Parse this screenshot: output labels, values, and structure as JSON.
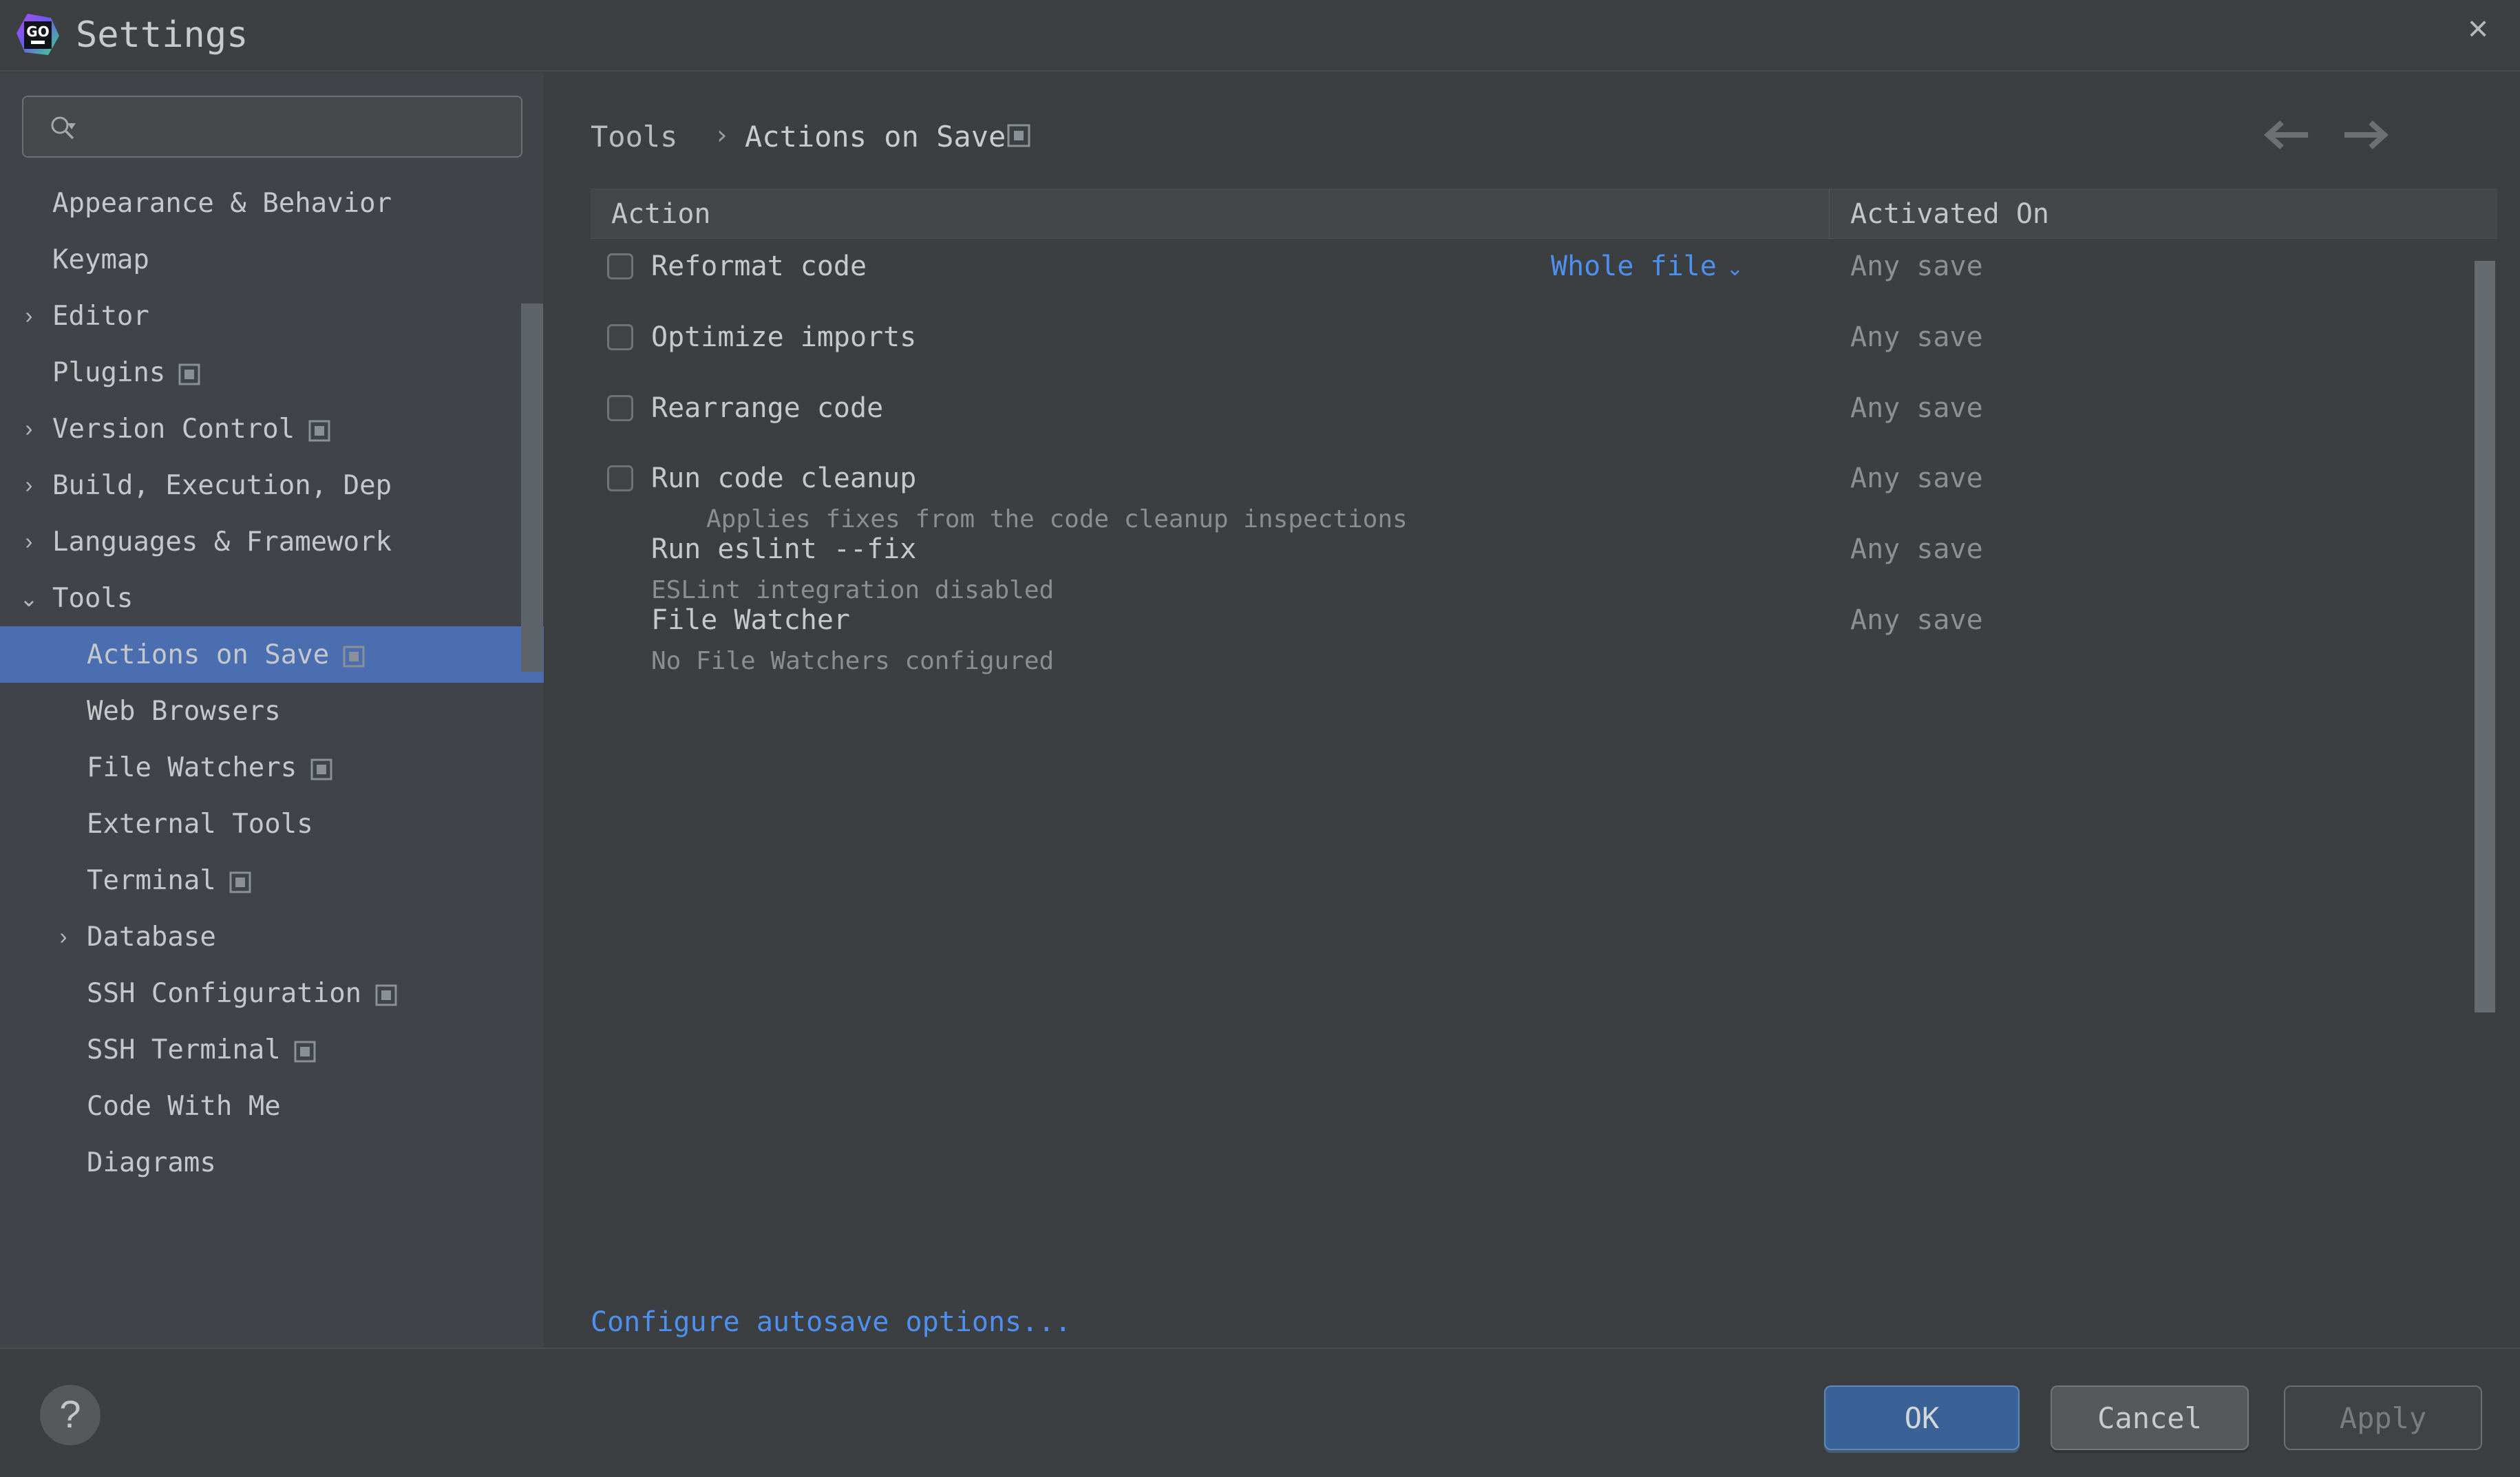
{
  "window": {
    "title": "Settings",
    "logo_text": "GO",
    "close_icon": "×"
  },
  "sidebar": {
    "search": {
      "value": "",
      "placeholder": ""
    },
    "items": [
      {
        "label": "Appearance & Behavior",
        "indent": 0,
        "chevron": "",
        "badge": false,
        "selected": false
      },
      {
        "label": "Keymap",
        "indent": 0,
        "chevron": "",
        "badge": false,
        "selected": false
      },
      {
        "label": "Editor",
        "indent": 0,
        "chevron": "›",
        "badge": false,
        "selected": false
      },
      {
        "label": "Plugins",
        "indent": 0,
        "chevron": "",
        "badge": true,
        "selected": false
      },
      {
        "label": "Version Control",
        "indent": 0,
        "chevron": "›",
        "badge": true,
        "selected": false
      },
      {
        "label": "Build, Execution, Dep",
        "indent": 0,
        "chevron": "›",
        "badge": false,
        "selected": false
      },
      {
        "label": "Languages & Framework",
        "indent": 0,
        "chevron": "›",
        "badge": false,
        "selected": false
      },
      {
        "label": "Tools",
        "indent": 0,
        "chevron": "⌄",
        "badge": false,
        "selected": false
      },
      {
        "label": "Actions on Save",
        "indent": 1,
        "chevron": "",
        "badge": true,
        "selected": true
      },
      {
        "label": "Web Browsers",
        "indent": 1,
        "chevron": "",
        "badge": false,
        "selected": false
      },
      {
        "label": "File Watchers",
        "indent": 1,
        "chevron": "",
        "badge": true,
        "selected": false
      },
      {
        "label": "External Tools",
        "indent": 1,
        "chevron": "",
        "badge": false,
        "selected": false
      },
      {
        "label": "Terminal",
        "indent": 1,
        "chevron": "",
        "badge": true,
        "selected": false
      },
      {
        "label": "Database",
        "indent": 1,
        "chevron": "›",
        "badge": false,
        "selected": false
      },
      {
        "label": "SSH Configuration",
        "indent": 1,
        "chevron": "",
        "badge": true,
        "selected": false
      },
      {
        "label": "SSH Terminal",
        "indent": 1,
        "chevron": "",
        "badge": true,
        "selected": false
      },
      {
        "label": "Code With Me",
        "indent": 1,
        "chevron": "",
        "badge": false,
        "selected": false
      },
      {
        "label": "Diagrams",
        "indent": 1,
        "chevron": "",
        "badge": false,
        "selected": false
      }
    ]
  },
  "content": {
    "breadcrumb": {
      "root": "Tools",
      "separator": "›",
      "leaf": "Actions on Save"
    },
    "nav": {
      "back_icon": "←",
      "forward_icon": "→"
    },
    "table": {
      "columns": [
        "Action",
        "Activated On"
      ],
      "rows": [
        {
          "label": "Reformat code",
          "checkbox": true,
          "checked": false,
          "description": "",
          "option": "Whole file",
          "option_chevron": "⌄",
          "activated_on": "Any save"
        },
        {
          "label": "Optimize imports",
          "checkbox": true,
          "checked": false,
          "description": "",
          "option": "",
          "option_chevron": "",
          "activated_on": "Any save"
        },
        {
          "label": "Rearrange code",
          "checkbox": true,
          "checked": false,
          "description": "",
          "option": "",
          "option_chevron": "",
          "activated_on": "Any save"
        },
        {
          "label": "Run code cleanup",
          "checkbox": true,
          "checked": false,
          "description": "Applies fixes from the code cleanup inspections",
          "option": "",
          "option_chevron": "",
          "activated_on": "Any save"
        },
        {
          "label": "Run eslint --fix",
          "checkbox": false,
          "checked": false,
          "description": "ESLint integration disabled",
          "option": "",
          "option_chevron": "",
          "activated_on": "Any save"
        },
        {
          "label": "File Watcher",
          "checkbox": false,
          "checked": false,
          "description": "No File Watchers configured",
          "option": "",
          "option_chevron": "",
          "activated_on": "Any save"
        }
      ]
    },
    "autosave_link": "Configure autosave options..."
  },
  "footer": {
    "help_label": "?",
    "ok_label": "OK",
    "cancel_label": "Cancel",
    "apply_label": "Apply"
  },
  "colors": {
    "selection_blue": "#4a6eb0",
    "link_blue": "#4d90f0",
    "ok_button_blue": "#3a6296",
    "window_bg": "#3c3f41",
    "sidebar_bg": "#404448"
  }
}
